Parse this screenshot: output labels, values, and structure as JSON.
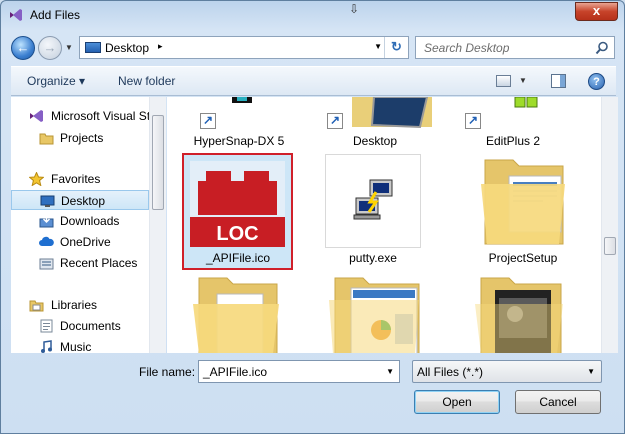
{
  "window": {
    "title": "Add Files",
    "close_label": "x"
  },
  "address_bar": {
    "location": "Desktop",
    "separator": "▸"
  },
  "search": {
    "placeholder": "Search Desktop"
  },
  "toolbar": {
    "organize_label": "Organize ▾",
    "new_folder_label": "New folder"
  },
  "nav": {
    "items": [
      {
        "label": "Microsoft Visual St",
        "icon": "visual-studio-icon"
      },
      {
        "label": "Projects",
        "icon": "folder-icon"
      },
      {
        "label": "Favorites",
        "icon": "star-icon"
      },
      {
        "label": "Desktop",
        "icon": "desktop-icon",
        "selected": true
      },
      {
        "label": "Downloads",
        "icon": "downloads-icon"
      },
      {
        "label": "OneDrive",
        "icon": "cloud-icon"
      },
      {
        "label": "Recent Places",
        "icon": "recent-places-icon"
      },
      {
        "label": "Libraries",
        "icon": "libraries-icon"
      },
      {
        "label": "Documents",
        "icon": "documents-icon"
      },
      {
        "label": "Music",
        "icon": "music-icon"
      }
    ]
  },
  "files": [
    {
      "name": "HyperSnap-DX 5",
      "icon": "hypersnap-icon"
    },
    {
      "name": "Desktop",
      "icon": "desktop-shortcut-icon"
    },
    {
      "name": "EditPlus 2",
      "icon": "editplus-icon"
    },
    {
      "name": "_APIFile.ico",
      "icon": "loc-icon",
      "selected": true,
      "thumb_text": "LOC"
    },
    {
      "name": "putty.exe",
      "icon": "putty-icon"
    },
    {
      "name": "ProjectSetup",
      "icon": "folder-icon"
    },
    {
      "name": "",
      "icon": "folder-icon"
    },
    {
      "name": "",
      "icon": "folder-icon"
    },
    {
      "name": "",
      "icon": "folder-icon"
    }
  ],
  "footer": {
    "file_name_label": "File name:",
    "file_name_value": "_APIFile.ico",
    "filter_value": "All Files (*.*)",
    "open_label": "Open",
    "cancel_label": "Cancel"
  },
  "colors": {
    "accent": "#3c7fb1",
    "selection_border": "#d0202a",
    "loc_red": "#c81e24"
  }
}
